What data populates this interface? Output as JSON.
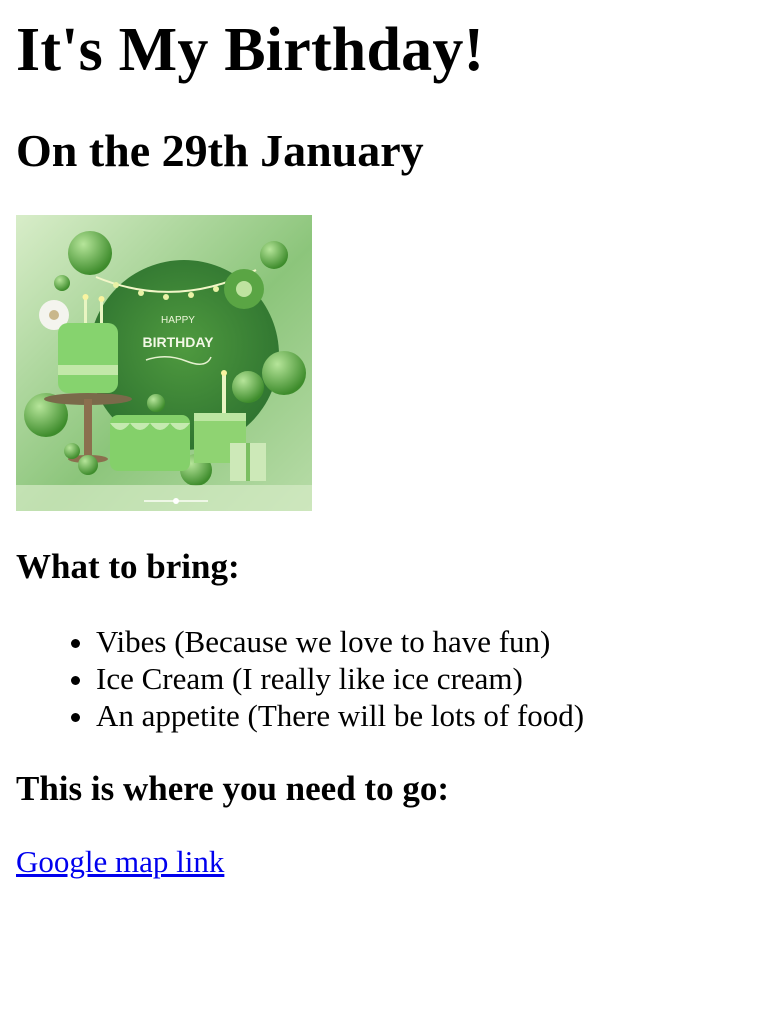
{
  "page": {
    "title": "It's My Birthday!",
    "subtitle": "On the 29th January"
  },
  "image": {
    "icon": "birthday-cake-image",
    "text_top": "HAPPY",
    "text_main": "BIRTHDAY",
    "colors": {
      "bg_light": "#cfe7c2",
      "bg_mid": "#79b56a",
      "bg_dark": "#3f8a3a",
      "cake": "#7fcf6d",
      "balloon": "#5fae4a"
    }
  },
  "bring": {
    "heading": "What to bring:",
    "items": [
      {
        "text": "Vibes (Because we love to have fun)"
      },
      {
        "text": "Ice Cream (I really like ice cream)"
      },
      {
        "text": "An appetite (There will be lots of food)"
      }
    ]
  },
  "directions": {
    "heading": "This is where you need to go:",
    "link_text": "Google map link",
    "link_color": "#0000ee"
  }
}
